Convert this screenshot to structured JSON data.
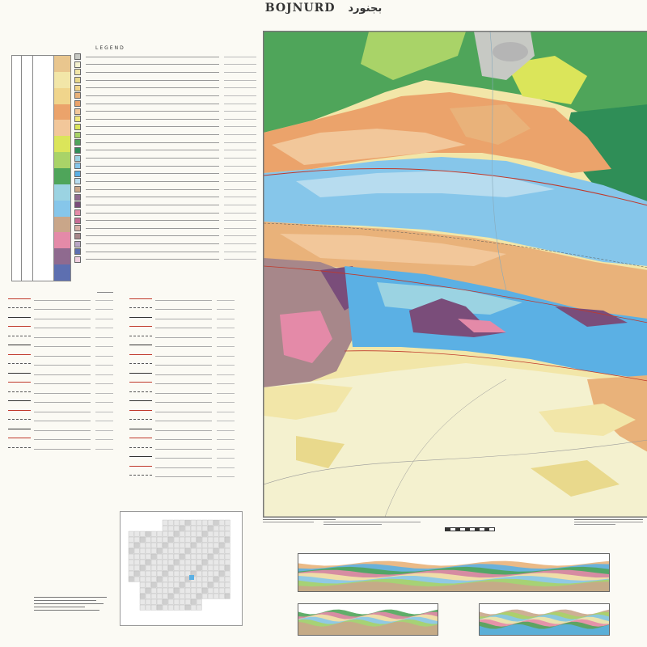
{
  "header": {
    "title_en": "BOJNURD",
    "title_fa": "بجنورد"
  },
  "legend": {
    "heading": "LEGEND",
    "units": [
      {
        "color": "#c7c9c4"
      },
      {
        "color": "#f4f1cf"
      },
      {
        "color": "#f2e6a8"
      },
      {
        "color": "#e9d98c"
      },
      {
        "color": "#f0d58c"
      },
      {
        "color": "#e9b27a"
      },
      {
        "color": "#eba36b"
      },
      {
        "color": "#f2c79a"
      },
      {
        "color": "#f1e77b"
      },
      {
        "color": "#dbe55a"
      },
      {
        "color": "#a9d368"
      },
      {
        "color": "#4fa55a"
      },
      {
        "color": "#2f8e57"
      },
      {
        "color": "#9bd3e2"
      },
      {
        "color": "#86c6ea"
      },
      {
        "color": "#5bb0e4"
      },
      {
        "color": "#b7dcef"
      },
      {
        "color": "#c9a689"
      },
      {
        "color": "#8f6a8f"
      },
      {
        "color": "#7a4d7a"
      },
      {
        "color": "#e48aa8"
      },
      {
        "color": "#c76d95"
      },
      {
        "color": "#d7b0a7"
      },
      {
        "color": "#a7878a"
      },
      {
        "color": "#b9a6c6"
      },
      {
        "color": "#5d6fb0"
      },
      {
        "color": "#f0cfe0"
      }
    ],
    "strat": {
      "age_colors": [
        "#e9c68e",
        "#f2e6a8",
        "#f0d58c",
        "#eba36b",
        "#f2c79a",
        "#dbe55a",
        "#a9d368",
        "#4fa55a",
        "#9bd3e2",
        "#86c6ea",
        "#c9a689",
        "#e48aa8",
        "#8f6a8f",
        "#5d6fb0"
      ]
    }
  },
  "map_units": {
    "green": "#4fa55a",
    "dark_green": "#2f8e57",
    "light_green": "#a9d368",
    "yellow_green": "#dbe55a",
    "orange": "#eba36b",
    "tan": "#e9b27a",
    "peach": "#f2c79a",
    "cream": "#f4f1cf",
    "pale_yellow": "#f2e6a8",
    "light_blue": "#9bd3e2",
    "blue": "#5bb0e4",
    "mid_blue": "#86c6ea",
    "pale_blue": "#b7dcef",
    "purple": "#7a4d7a",
    "mauve": "#a7878a",
    "pink": "#e48aa8",
    "brown": "#c9a689",
    "grey": "#c7c9c4",
    "red": "#c0392b"
  },
  "symbols": {
    "col1_count": 17,
    "col2_count": 20,
    "col1_headings": [
      "Geological structures",
      "Strike and dip",
      "Hydrographic"
    ],
    "col2_headings": [
      "Geography and Morphology"
    ]
  },
  "sections": {
    "colors": [
      "#e9b27a",
      "#5bb0e4",
      "#4fa55a",
      "#e48aa8",
      "#f2e6a8",
      "#86c6ea",
      "#a9d368",
      "#c9a689"
    ]
  }
}
